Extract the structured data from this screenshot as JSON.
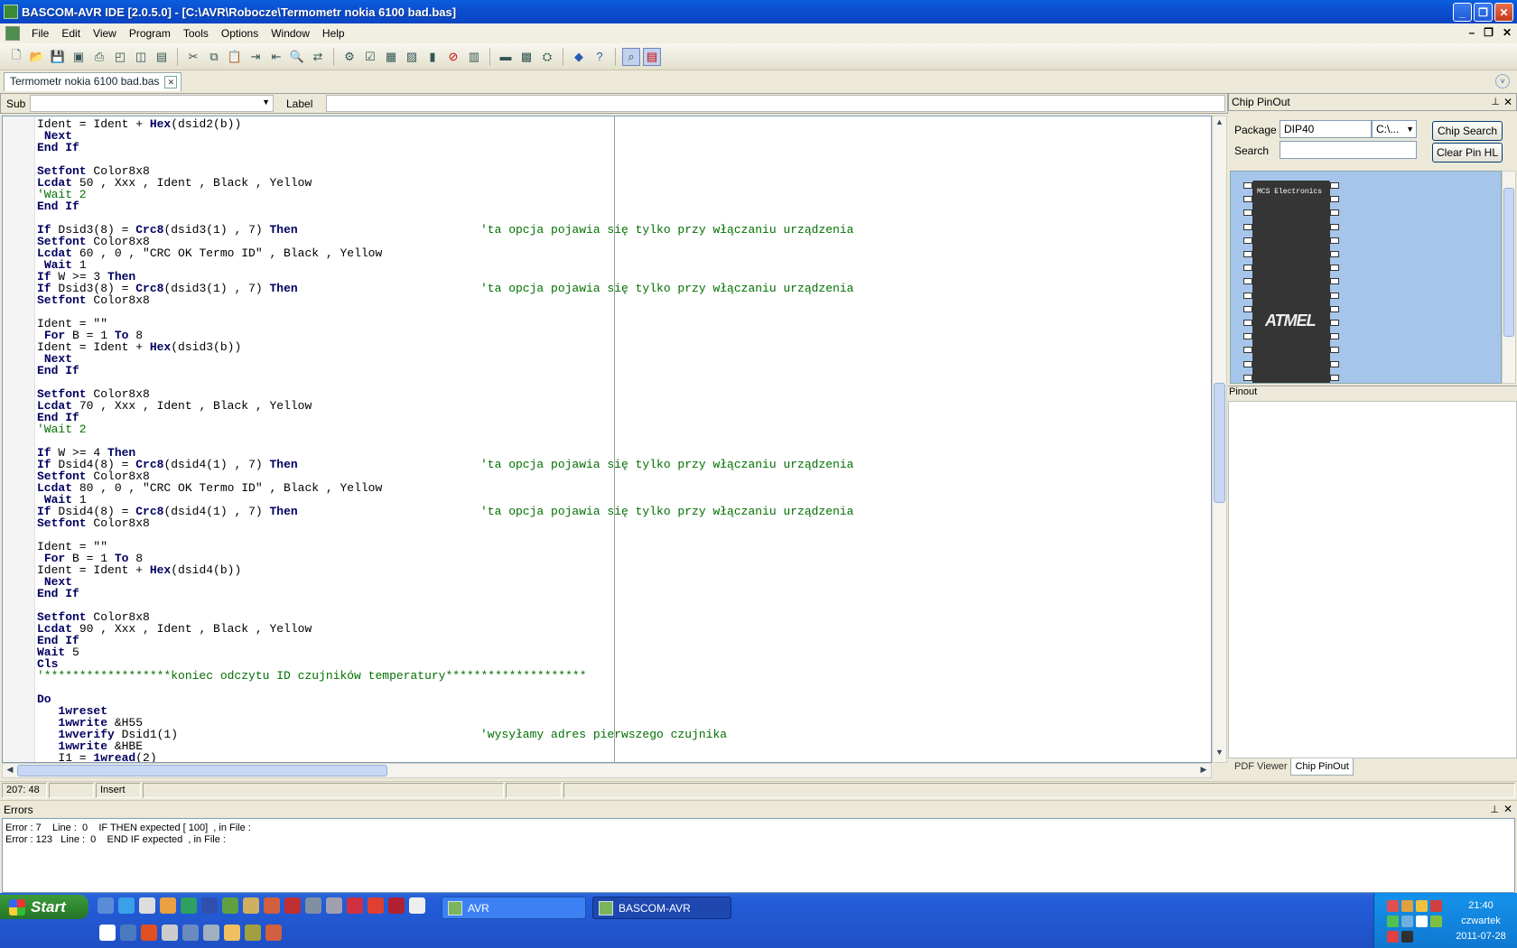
{
  "window": {
    "title": "BASCOM-AVR IDE [2.0.5.0] - [C:\\AVR\\Robocze\\Termometr nokia 6100 bad.bas]"
  },
  "menu": {
    "items": [
      "File",
      "Edit",
      "View",
      "Program",
      "Tools",
      "Options",
      "Window",
      "Help"
    ]
  },
  "toolbar": {
    "icons": [
      "new-file",
      "open-file",
      "save",
      "save-all",
      "print",
      "print-preview",
      "find-in-files",
      "open-recent",
      "cut",
      "copy",
      "paste",
      "indent",
      "unindent",
      "find",
      "replace",
      "compile",
      "syntax-check",
      "program-chip",
      "send-to-chip",
      "terminal",
      "stop",
      "lcd-designer",
      "lib-manager",
      "simulator",
      "graphic-converter",
      "plugins",
      "info",
      "help",
      "zoom",
      "pdf"
    ]
  },
  "file_tab": {
    "label": "Termometr nokia 6100 bad.bas"
  },
  "editor": {
    "sub_label": "Sub",
    "label_label": "Label",
    "lines": [
      {
        "code": "Ident = Ident + Hex(dsid2(b))",
        "comment": ""
      },
      {
        "code": " Next",
        "comment": ""
      },
      {
        "code": "End If",
        "comment": ""
      },
      {
        "code": "",
        "comment": ""
      },
      {
        "code": "Setfont Color8x8",
        "comment": ""
      },
      {
        "code": "Lcdat 50 , Xxx , Ident , Black , Yellow",
        "comment": ""
      },
      {
        "code": "",
        "comment": "'Wait 2",
        "indent_comment": true
      },
      {
        "code": "End If",
        "comment": ""
      },
      {
        "code": "",
        "comment": ""
      },
      {
        "code": "If Dsid3(8) = Crc8(dsid3(1) , 7) Then",
        "comment": "'ta opcja pojawia się tylko przy włączaniu urządzenia"
      },
      {
        "code": "Setfont Color8x8",
        "comment": ""
      },
      {
        "code": "Lcdat 60 , 0 , \"CRC OK Termo ID\" , Black , Yellow",
        "comment": ""
      },
      {
        "code": " Wait 1",
        "comment": ""
      },
      {
        "code": "If W >= 3 Then",
        "comment": ""
      },
      {
        "code": "If Dsid3(8) = Crc8(dsid3(1) , 7) Then",
        "comment": "'ta opcja pojawia się tylko przy włączaniu urządzenia"
      },
      {
        "code": "Setfont Color8x8",
        "comment": ""
      },
      {
        "code": "",
        "comment": ""
      },
      {
        "code": "Ident = \"\"",
        "comment": ""
      },
      {
        "code": " For B = 1 To 8",
        "comment": ""
      },
      {
        "code": "Ident = Ident + Hex(dsid3(b))",
        "comment": ""
      },
      {
        "code": " Next",
        "comment": ""
      },
      {
        "code": "End If",
        "comment": ""
      },
      {
        "code": "",
        "comment": ""
      },
      {
        "code": "Setfont Color8x8",
        "comment": ""
      },
      {
        "code": "Lcdat 70 , Xxx , Ident , Black , Yellow",
        "comment": ""
      },
      {
        "code": "End If",
        "comment": ""
      },
      {
        "code": "",
        "comment": "'Wait 2",
        "indent_comment": true
      },
      {
        "code": "",
        "comment": ""
      },
      {
        "code": "If W >= 4 Then",
        "comment": ""
      },
      {
        "code": "If Dsid4(8) = Crc8(dsid4(1) , 7) Then",
        "comment": "'ta opcja pojawia się tylko przy włączaniu urządzenia"
      },
      {
        "code": "Setfont Color8x8",
        "comment": ""
      },
      {
        "code": "Lcdat 80 , 0 , \"CRC OK Termo ID\" , Black , Yellow",
        "comment": ""
      },
      {
        "code": " Wait 1",
        "comment": ""
      },
      {
        "code": "If Dsid4(8) = Crc8(dsid4(1) , 7) Then",
        "comment": "'ta opcja pojawia się tylko przy włączaniu urządzenia"
      },
      {
        "code": "Setfont Color8x8",
        "comment": ""
      },
      {
        "code": "",
        "comment": ""
      },
      {
        "code": "Ident = \"\"",
        "comment": ""
      },
      {
        "code": " For B = 1 To 8",
        "comment": ""
      },
      {
        "code": "Ident = Ident + Hex(dsid4(b))",
        "comment": ""
      },
      {
        "code": " Next",
        "comment": ""
      },
      {
        "code": "End If",
        "comment": ""
      },
      {
        "code": "",
        "comment": ""
      },
      {
        "code": "Setfont Color8x8",
        "comment": ""
      },
      {
        "code": "Lcdat 90 , Xxx , Ident , Black , Yellow",
        "comment": ""
      },
      {
        "code": "End If",
        "comment": ""
      },
      {
        "code": "Wait 5",
        "comment": ""
      },
      {
        "code": "Cls",
        "comment": ""
      },
      {
        "code": "",
        "comment": "'******************koniec odczytu ID czujników temperatury********************",
        "indent_comment": true
      },
      {
        "code": "",
        "comment": ""
      },
      {
        "code": "Do",
        "comment": ""
      },
      {
        "code": "   1wreset",
        "comment": ""
      },
      {
        "code": "   1wwrite &H55",
        "comment": ""
      },
      {
        "code": "   1wverify Dsid1(1)",
        "comment": "'wysyłamy adres pierwszego czujnika"
      },
      {
        "code": "   1wwrite &HBE",
        "comment": ""
      },
      {
        "code": "   I1 = 1wread(2)",
        "comment": ""
      }
    ]
  },
  "status": {
    "position": "207: 48",
    "cell2": "",
    "mode": "Insert",
    "cell4": "",
    "cell5": "",
    "cell6": ""
  },
  "errors": {
    "title": "Errors",
    "lines": [
      "Error : 7    Line :  0    IF THEN expected [ 100]  , in File :",
      "Error : 123   Line :  0    END IF expected  , in File :"
    ]
  },
  "chip_panel": {
    "title": "Chip PinOut",
    "package_label": "Package",
    "package_value": "DIP40",
    "path_value": "C:\\...",
    "search_label": "Search",
    "search_value": "",
    "chip_search_button": "Chip Search",
    "clear_pin_button": "Clear Pin HL",
    "chip_maker_text": "MCS Electronics",
    "pinout_label": "Pinout",
    "tabs": [
      "PDF Viewer",
      "Chip PinOut"
    ],
    "active_tab": "Chip PinOut"
  },
  "taskbar": {
    "start_label": "Start",
    "tasks": [
      "AVR",
      "BASCOM-AVR"
    ],
    "clock_time": "21:40",
    "clock_day": "czwartek",
    "clock_date": "2011-07-28"
  }
}
